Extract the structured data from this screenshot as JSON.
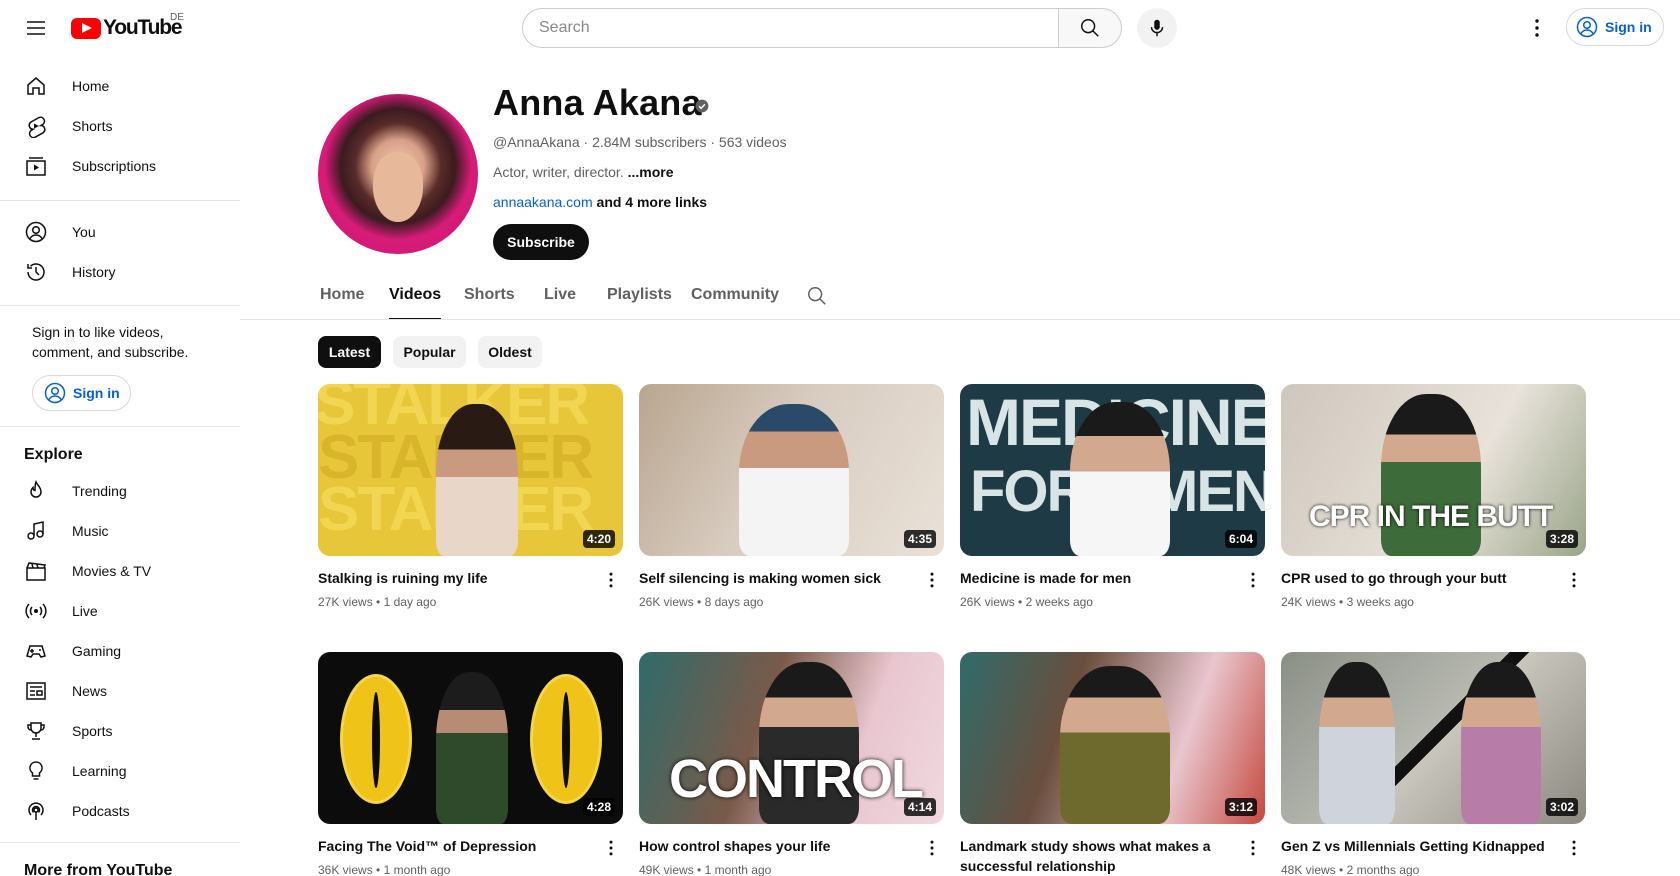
{
  "app": {
    "logo_text": "YouTube",
    "region": "DE"
  },
  "header": {
    "search_placeholder": "Search",
    "signin_label": "Sign in"
  },
  "sidebar": {
    "primary": [
      {
        "label": "Home",
        "icon": "home-icon"
      },
      {
        "label": "Shorts",
        "icon": "shorts-icon"
      },
      {
        "label": "Subscriptions",
        "icon": "subscriptions-icon"
      }
    ],
    "secondary": [
      {
        "label": "You",
        "icon": "you-icon"
      },
      {
        "label": "History",
        "icon": "history-icon"
      }
    ],
    "signin_prompt": "Sign in to like videos, comment, and subscribe.",
    "signin_label": "Sign in",
    "explore_title": "Explore",
    "explore": [
      {
        "label": "Trending",
        "icon": "trending-icon"
      },
      {
        "label": "Music",
        "icon": "music-icon"
      },
      {
        "label": "Movies & TV",
        "icon": "movies-icon"
      },
      {
        "label": "Live",
        "icon": "live-icon"
      },
      {
        "label": "Gaming",
        "icon": "gaming-icon"
      },
      {
        "label": "News",
        "icon": "news-icon"
      },
      {
        "label": "Sports",
        "icon": "sports-icon"
      },
      {
        "label": "Learning",
        "icon": "learning-icon"
      },
      {
        "label": "Podcasts",
        "icon": "podcasts-icon"
      }
    ],
    "more_title": "More from YouTube"
  },
  "channel": {
    "name": "Anna Akana",
    "handle": "@AnnaAkana",
    "subscribers": "2.84M subscribers",
    "videos_count": "563 videos",
    "description": "Actor, writer, director.",
    "more_label": "...more",
    "link": "annaakana.com",
    "more_links": "and 4 more links",
    "subscribe_label": "Subscribe"
  },
  "tabs": [
    {
      "label": "Home",
      "active": false
    },
    {
      "label": "Videos",
      "active": true
    },
    {
      "label": "Shorts",
      "active": false
    },
    {
      "label": "Live",
      "active": false
    },
    {
      "label": "Playlists",
      "active": false
    },
    {
      "label": "Community",
      "active": false
    }
  ],
  "chips": [
    {
      "label": "Latest",
      "active": true
    },
    {
      "label": "Popular",
      "active": false
    },
    {
      "label": "Oldest",
      "active": false
    }
  ],
  "videos": [
    {
      "title": "Stalking is ruining my life",
      "views": "27K views",
      "age": "1 day ago",
      "duration": "4:20",
      "thumb_text": "STALKER"
    },
    {
      "title": "Self silencing is making women sick",
      "views": "26K views",
      "age": "8 days ago",
      "duration": "4:35",
      "thumb_text": ""
    },
    {
      "title": "Medicine is made for men",
      "views": "26K views",
      "age": "2 weeks ago",
      "duration": "6:04",
      "thumb_text": "MEDICINE"
    },
    {
      "title": "CPR used to go through your butt",
      "views": "24K views",
      "age": "3 weeks ago",
      "duration": "3:28",
      "thumb_text": "CPR IN THE BUTT"
    },
    {
      "title": "Facing The Void™ of Depression",
      "views": "36K views",
      "age": "1 month ago",
      "duration": "4:28",
      "thumb_text": ""
    },
    {
      "title": "How control shapes your life",
      "views": "49K views",
      "age": "1 month ago",
      "duration": "4:14",
      "thumb_text": "CONTROL"
    },
    {
      "title": "Landmark study shows what makes a successful relationship",
      "views": "",
      "age": "",
      "duration": "3:12",
      "thumb_text": ""
    },
    {
      "title": "Gen Z vs Millennials Getting Kidnapped",
      "views": "48K views",
      "age": "2 months ago",
      "duration": "3:02",
      "thumb_text": ""
    }
  ],
  "meta_separator": "•",
  "colors": {
    "brand_red": "#ff0000",
    "link_blue": "#065fd4",
    "text_secondary": "#606060"
  }
}
